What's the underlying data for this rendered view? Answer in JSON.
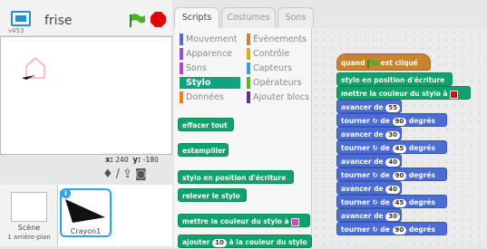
{
  "app": {
    "version": "v453",
    "project_name": "frise"
  },
  "coords": {
    "x_label": "x:",
    "x": "240",
    "y_label": "y:",
    "y": "-180"
  },
  "scene": {
    "name": "Scène",
    "sub": "1 arrière-plan"
  },
  "sprite": {
    "name": "Crayon1"
  },
  "tabs": [
    "Scripts",
    "Costumes",
    "Sons"
  ],
  "categories": [
    {
      "label": "Mouvement",
      "color": "#4a6cd4"
    },
    {
      "label": "Évènements",
      "color": "#c88330"
    },
    {
      "label": "Apparence",
      "color": "#8a55d7"
    },
    {
      "label": "Contrôle",
      "color": "#e1a91a"
    },
    {
      "label": "Sons",
      "color": "#bb42c3"
    },
    {
      "label": "Capteurs",
      "color": "#2ca5e2"
    },
    {
      "label": "Stylo",
      "color": "#0fa36b"
    },
    {
      "label": "Opérateurs",
      "color": "#5cb712"
    },
    {
      "label": "Données",
      "color": "#ee7d16"
    },
    {
      "label": "Ajouter blocs",
      "color": "#632d99"
    }
  ],
  "palette_blocks": [
    "effacer tout",
    "estampiller",
    "stylo en position d'écriture",
    "relever le stylo",
    "mettre la couleur du stylo à",
    "ajouter",
    "à la couleur du stylo"
  ],
  "palette_add_value": "10",
  "pen_color": "#e040c0",
  "script": {
    "hat_prefix": "quand",
    "hat_suffix": "est cliqué",
    "b1": "stylo en position d'écriture",
    "b2": "mettre la couleur du stylo à",
    "avancer": "avancer de",
    "tourner": "tourner ↻ de",
    "degres": "degrés",
    "v1": "55",
    "v2": "90",
    "v3": "30",
    "v4": "45",
    "v5": "40",
    "v6": "90",
    "v7": "40",
    "v8": "45",
    "v9": "30",
    "v10": "90"
  },
  "script_color": "#e3000b"
}
